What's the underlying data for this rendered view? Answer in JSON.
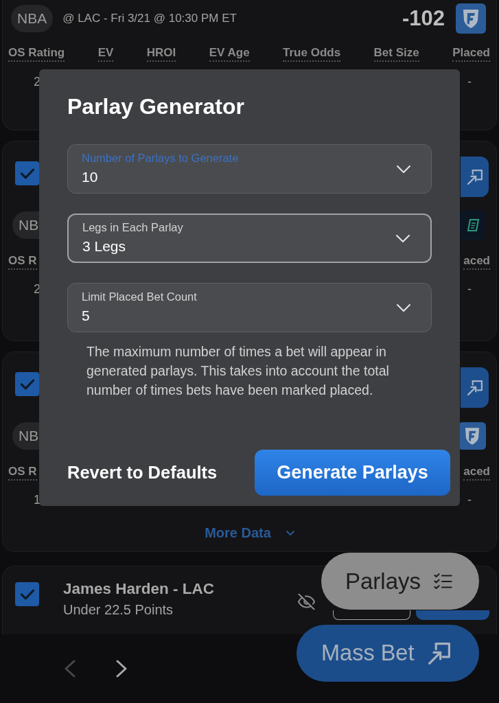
{
  "bets": [
    {
      "kind": "top",
      "league": "NBA",
      "event": "@ LAC - Fri 3/21 @ 10:30 PM ET",
      "odds": "-102",
      "book": {
        "kind": "shield"
      },
      "columns": [
        "OS Rating",
        "EV",
        "HROI",
        "EV Age",
        "True Odds",
        "Bet Size",
        "Placed"
      ],
      "values": [
        "2",
        "-"
      ]
    },
    {
      "kind": "clipped",
      "checked": true,
      "league": "NB",
      "book": {
        "kind": "tile"
      },
      "columns": [
        "OS R",
        "aced"
      ],
      "values": [
        "2",
        "-"
      ]
    },
    {
      "kind": "clipped",
      "checked": true,
      "league": "NB",
      "book": {
        "kind": "shield"
      },
      "columns": [
        "OS R",
        "aced"
      ],
      "values": [
        "1",
        "-"
      ],
      "more_link": "More Data"
    },
    {
      "kind": "prop",
      "checked": true,
      "player": "James Harden - LAC",
      "line": "Under 22.5 Points"
    }
  ],
  "dialog": {
    "title": "Parlay Generator",
    "fields": [
      {
        "label": "Number of Parlays to Generate",
        "value": "10",
        "focused": true,
        "hovered": false
      },
      {
        "label": "Legs in Each Parlay",
        "value": "3 Legs",
        "focused": false,
        "hovered": true
      },
      {
        "label": "Limit Placed Bet Count",
        "value": "5",
        "focused": false,
        "hovered": false
      }
    ],
    "help": "The maximum number of times a bet will appear in generated parlays. This takes into account the total number of times bets have been marked placed.",
    "buttons": [
      {
        "kind": "text",
        "label": "Revert to Defaults"
      },
      {
        "kind": "primary",
        "label": "Generate Parlays"
      }
    ]
  },
  "floating_buttons": [
    {
      "kind": "secondary",
      "label": "Parlays"
    },
    {
      "kind": "primary",
      "label": "Mass Bet"
    }
  ],
  "pager": {
    "prev": {
      "disabled": true
    },
    "next": {
      "disabled": false
    }
  }
}
